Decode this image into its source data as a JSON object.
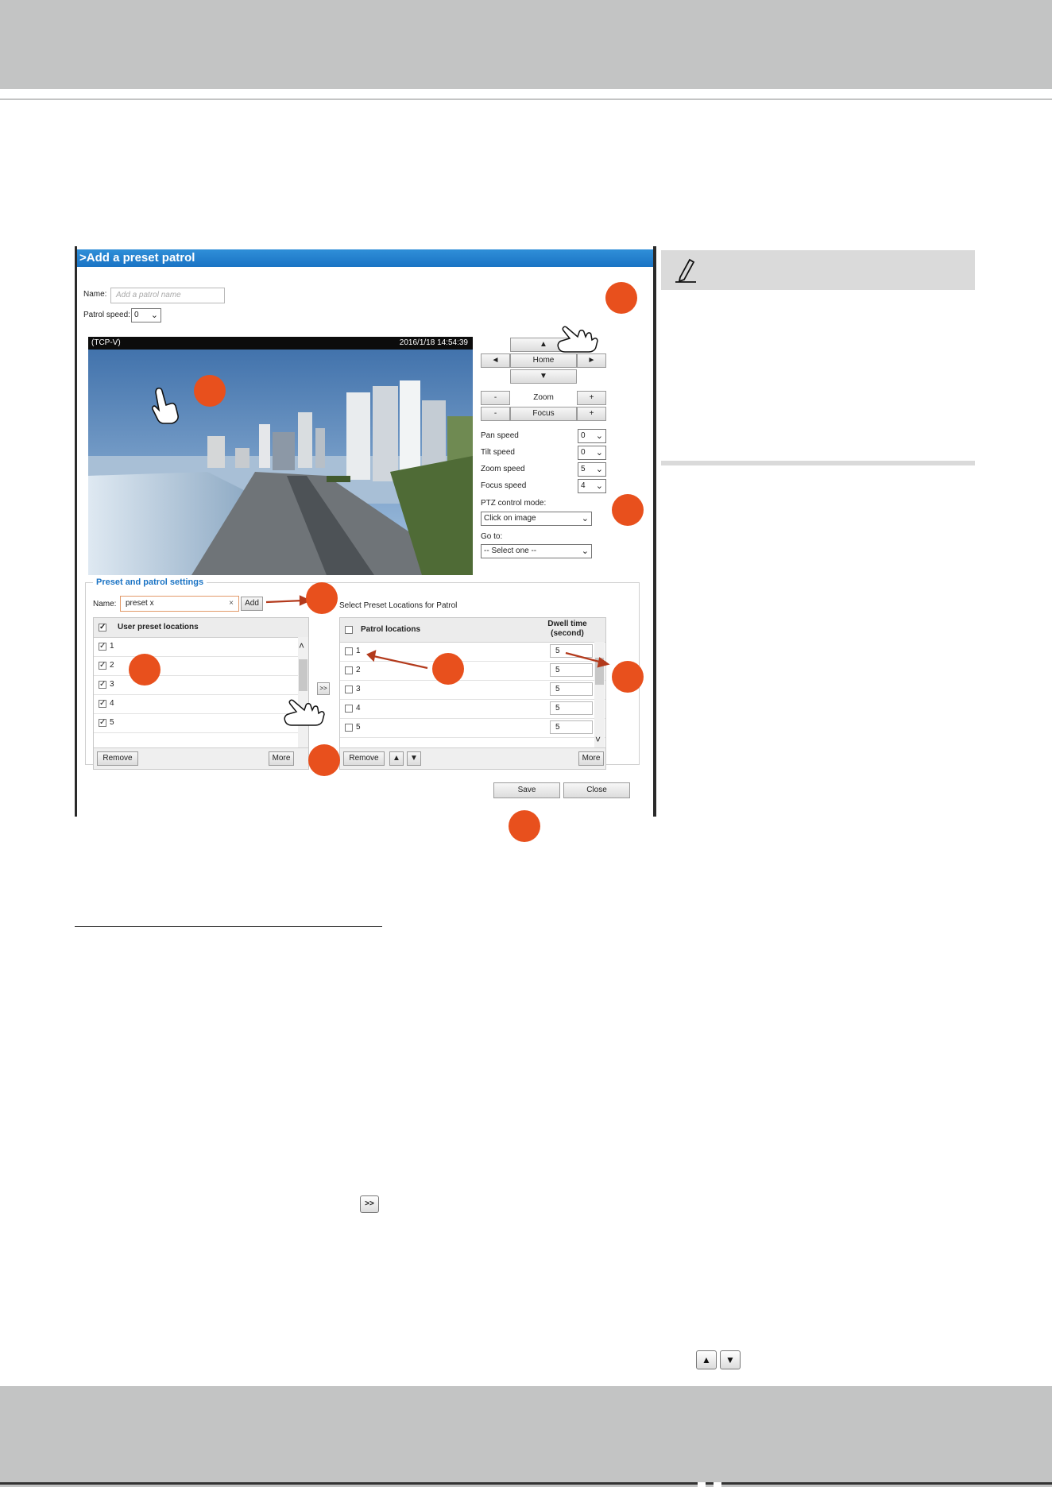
{
  "dialog": {
    "title": ">Add a preset patrol",
    "name_label": "Name:",
    "name_placeholder": "Add a patrol name",
    "patrol_speed_label": "Patrol speed:",
    "patrol_speed_value": "0",
    "video": {
      "stream_label": "(TCP-V)",
      "timestamp": "2016/1/18 14:54:39"
    },
    "ptz": {
      "up": "▲",
      "left": "◄",
      "home": "Home",
      "right": "►",
      "down": "▼",
      "zoom_minus": "-",
      "zoom_label": "Zoom",
      "zoom_plus": "+",
      "focus_minus": "-",
      "focus_label": "Focus",
      "focus_plus": "+",
      "speeds": [
        {
          "label": "Pan speed",
          "value": "0"
        },
        {
          "label": "Tilt speed",
          "value": "0"
        },
        {
          "label": "Zoom speed",
          "value": "5"
        },
        {
          "label": "Focus speed",
          "value": "4"
        }
      ],
      "control_mode_label": "PTZ control mode:",
      "control_mode_value": "Click on image",
      "goto_label": "Go to:",
      "goto_value": "-- Select one --"
    },
    "settings": {
      "legend": "Preset and patrol settings",
      "name_label": "Name:",
      "name_value": "preset x",
      "clear_icon": "×",
      "add_button": "Add",
      "select_label": "Select Preset Locations for Patrol",
      "user_header": "User preset locations",
      "user_items": [
        "1",
        "2",
        "3",
        "4",
        "5"
      ],
      "transfer_button": ">>",
      "remove_button": "Remove",
      "more_button": "More",
      "patrol_header": "Patrol locations",
      "dwell_header_1": "Dwell time",
      "dwell_header_2": "(second)",
      "patrol_items": [
        {
          "name": "1",
          "dwell": "5"
        },
        {
          "name": "2",
          "dwell": "5"
        },
        {
          "name": "3",
          "dwell": "5"
        },
        {
          "name": "4",
          "dwell": "5"
        },
        {
          "name": "5",
          "dwell": "5"
        }
      ],
      "patrol_remove_button": "Remove",
      "move_up_button": "▲",
      "move_down_button": "▼",
      "patrol_more_button": "More"
    },
    "save_button": "Save",
    "close_button": "Close"
  },
  "document": {
    "transfer_icon_label": ">>",
    "up_icon_label": "▲",
    "down_icon_label": "▼"
  },
  "colors": {
    "callout": "#e8501d",
    "title_bar": "#1a73c4",
    "band": "#c3c4c4"
  }
}
